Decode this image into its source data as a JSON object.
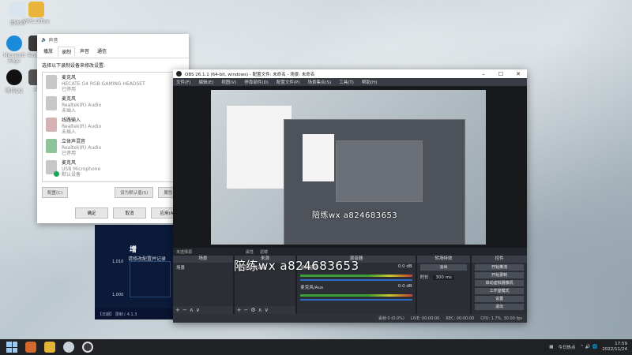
{
  "desktop": {
    "icons": [
      {
        "label": "回收站"
      },
      {
        "label": "WPS Office"
      },
      {
        "label": "Microsoft Edge"
      },
      {
        "label": "Tencent"
      },
      {
        "label": "腾讯QQ"
      },
      {
        "label": "AI"
      }
    ]
  },
  "sound_dialog": {
    "title": "声音",
    "tabs": [
      "播放",
      "录制",
      "声音",
      "通信"
    ],
    "active_tab": "录制",
    "hint": "选择以下录制设备来修改设置:",
    "devices": [
      {
        "name": "麦克风",
        "detail": "HECATE G4 RGB GAMING HEADSET",
        "status": "已停用"
      },
      {
        "name": "麦克风",
        "detail": "Realtek(R) Audio",
        "status": "未插入"
      },
      {
        "name": "线路输入",
        "detail": "Realtek(R) Audio",
        "status": "未插入"
      },
      {
        "name": "立体声混音",
        "detail": "Realtek(R) Audio",
        "status": "已停用"
      },
      {
        "name": "麦克风",
        "detail": "USB Microphone",
        "status": "默认设备"
      }
    ],
    "buttons": [
      "配置(C)",
      "设为默认值(S)",
      "属性(P)"
    ],
    "footer": [
      "确定",
      "取消",
      "应用(A)"
    ]
  },
  "background_app": {
    "title": "增",
    "caption": "请修改配置并记录",
    "y_labels": [
      "1,010",
      "1,000"
    ],
    "bottom": "【日期】 录制 ( 4.1.3"
  },
  "obs": {
    "title": "OBS 26.1.1 (64-bit, windows) - 配置文件: 未命名 - 场景: 未命名",
    "menu": [
      "文件(F)",
      "编辑(E)",
      "视图(V)",
      "停靠部件(D)",
      "配置文件(P)",
      "场景集合(S)",
      "工具(T)",
      "帮助(H)"
    ],
    "toolbar": {
      "source_none": "未选择源",
      "properties": "属性",
      "filters": "滤镜"
    },
    "panels": {
      "scenes": {
        "header": "场景",
        "items": [
          "场景"
        ]
      },
      "sources": {
        "header": "来源",
        "items": [
          "显示器采集"
        ]
      },
      "mixer": {
        "header": "混音器",
        "tracks": [
          {
            "name": "桌面音频",
            "db": "0.0 dB"
          },
          {
            "name": "麦克风/Aux",
            "db": "0.0 dB"
          }
        ]
      },
      "transitions": {
        "header": "转场特效",
        "type": "淡出",
        "duration_label": "时长",
        "duration": "300 ms"
      },
      "controls": {
        "header": "控件",
        "buttons": [
          "开始推流",
          "开始录制",
          "启动虚拟摄像机",
          "工作室模式",
          "设置",
          "退出"
        ]
      }
    },
    "status": {
      "dropped": "丢帧 0 (0.0%)",
      "live": "LIVE: 00:00:00",
      "rec": "REC: 00:00:00",
      "cpu": "CPU: 1.7%, 30.00 fps"
    },
    "watermark": "陪练wx  a824683653"
  },
  "taskbar": {
    "weather": "今日热点",
    "time": "17:59",
    "date": "2022/11/24"
  },
  "colors": {
    "obs_bg": "#292c33",
    "accent": "#2f69c6",
    "taskbar": "#1f2125"
  }
}
